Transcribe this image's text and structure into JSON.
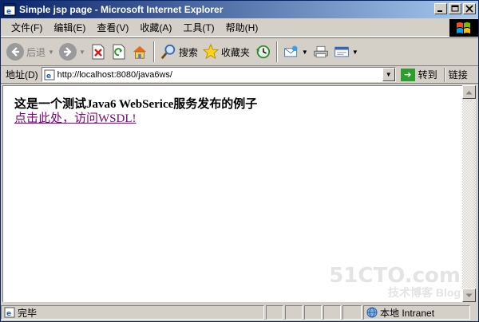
{
  "window": {
    "title": "Simple jsp page - Microsoft Internet Explorer"
  },
  "menu": {
    "items": [
      "文件(F)",
      "编辑(E)",
      "查看(V)",
      "收藏(A)",
      "工具(T)",
      "帮助(H)"
    ]
  },
  "toolbar": {
    "back_label": "后退",
    "search_label": "搜索",
    "favorites_label": "收藏夹"
  },
  "address": {
    "label": "地址(D)",
    "url": "http://localhost:8080/java6ws/",
    "go_label": "转到",
    "links_label": "链接"
  },
  "page": {
    "heading": "这是一个测试Java6 WebSerice服务发布的例子",
    "link_text": "点击此处，访问WSDL!"
  },
  "watermark": {
    "main": "51CTO.com",
    "sub": "技术博客",
    "blog": "Blog"
  },
  "status": {
    "text": "完毕",
    "zone": "本地 Intranet"
  },
  "colors": {
    "title_start": "#0a246a",
    "title_end": "#a6caf0",
    "link_visited": "#800080"
  }
}
